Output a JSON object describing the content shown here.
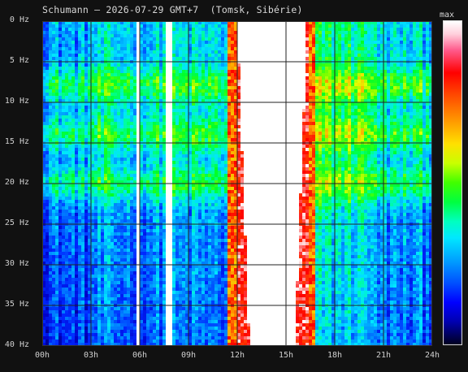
{
  "header": {
    "title": "Schumann – 2026-07-29 GMT+7  (Tomsk, Sibérie)"
  },
  "colorbar": {
    "label": "max"
  },
  "axes": {
    "y_ticks": [
      "0 Hz",
      "5 Hz",
      "10 Hz",
      "15 Hz",
      "20 Hz",
      "25 Hz",
      "30 Hz",
      "35 Hz",
      "40 Hz"
    ],
    "x_ticks": [
      "00h",
      "03h",
      "06h",
      "09h",
      "12h",
      "15h",
      "18h",
      "21h",
      "24h"
    ]
  },
  "chart_data": {
    "type": "heatmap",
    "title": "Schumann – 2026-07-29 GMT+7  (Tomsk, Sibérie)",
    "x_range_hours": [
      0,
      24
    ],
    "y_range_hz": [
      0,
      40
    ],
    "x_unit": "h",
    "y_unit": "Hz",
    "grid": true,
    "colorbar_max_label": "max",
    "saturated_intervals_hours": [
      [
        5.8,
        6.0
      ],
      [
        7.7,
        8.1
      ],
      [
        12.0,
        16.3
      ]
    ],
    "intensity_bands_hz": [
      8,
      14,
      20
    ]
  }
}
